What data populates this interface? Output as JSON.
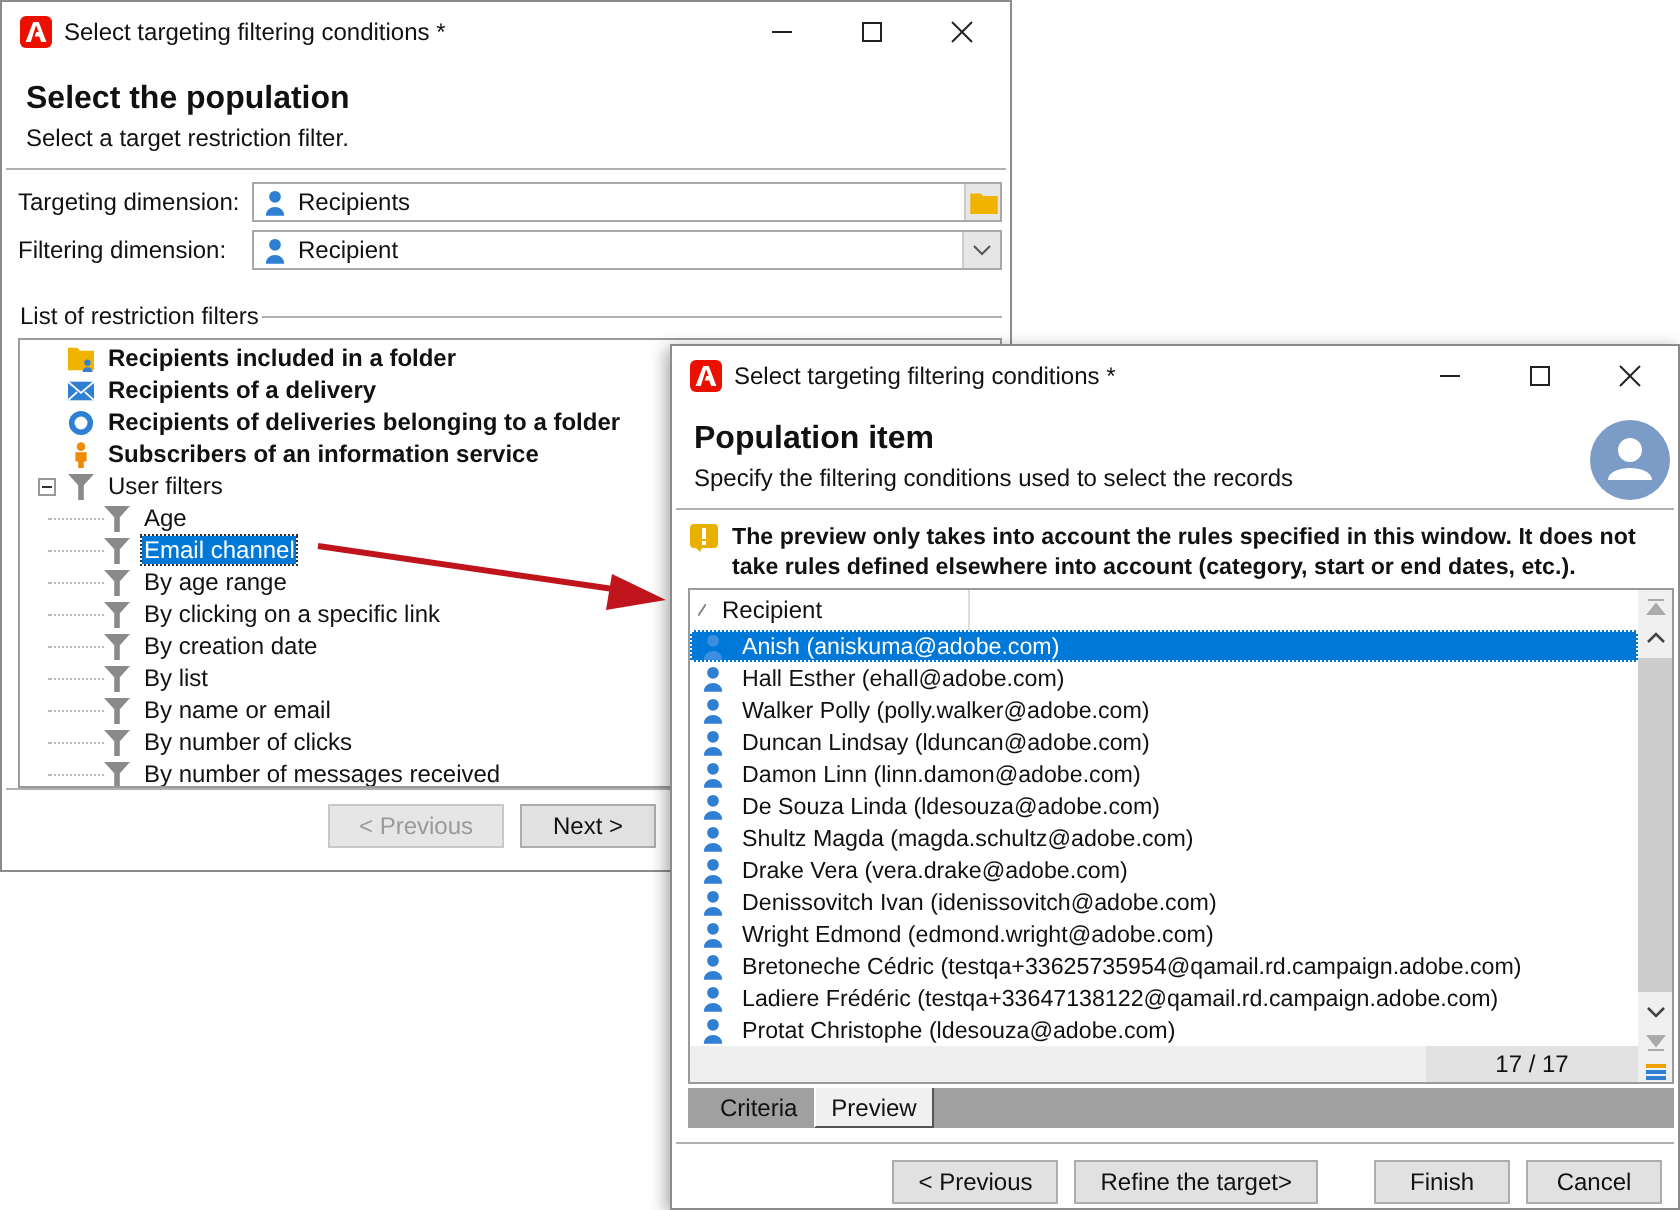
{
  "back_window": {
    "title": "Select targeting filtering conditions *",
    "header": {
      "title": "Select the population",
      "subtitle": "Select a target restriction filter."
    },
    "targeting_dimension": {
      "label": "Targeting dimension:",
      "value": "Recipients"
    },
    "filtering_dimension": {
      "label": "Filtering dimension:",
      "value": "Recipient"
    },
    "filters_section": {
      "label": "List of restriction filters"
    },
    "tree": [
      {
        "label": "Recipients included in a folder",
        "kind": "folder"
      },
      {
        "label": "Recipients of a delivery",
        "kind": "delivery"
      },
      {
        "label": "Recipients of deliveries belonging to a folder",
        "kind": "delivery-folder"
      },
      {
        "label": "Subscribers of an information service",
        "kind": "service"
      },
      {
        "label": "User filters",
        "kind": "filter",
        "expanded": true,
        "children": [
          {
            "label": "Age",
            "selected": false
          },
          {
            "label": "Email channel",
            "selected": true
          },
          {
            "label": "By age range",
            "selected": false
          },
          {
            "label": "By clicking on a specific link",
            "selected": false
          },
          {
            "label": "By creation date",
            "selected": false
          },
          {
            "label": "By list",
            "selected": false
          },
          {
            "label": "By name or email",
            "selected": false
          },
          {
            "label": "By number of clicks",
            "selected": false
          },
          {
            "label": "By number of messages received",
            "selected": false
          }
        ]
      }
    ],
    "buttons": [
      {
        "label": "< Previous",
        "disabled": true
      },
      {
        "label": "Next >",
        "disabled": false
      }
    ]
  },
  "front_window": {
    "title": "Select targeting filtering conditions *",
    "header": {
      "title": "Population item",
      "subtitle": "Specify the filtering conditions used to select the records"
    },
    "warning": "The preview only takes into account the rules specified in this window. It does not take rules defined elsewhere into account (category, start or end dates, etc.).",
    "list": {
      "column": "Recipient",
      "rows": [
        {
          "label": "Anish (aniskuma@adobe.com)",
          "selected": true
        },
        {
          "label": "Hall Esther (ehall@adobe.com)",
          "selected": false
        },
        {
          "label": "Walker Polly (polly.walker@adobe.com)",
          "selected": false
        },
        {
          "label": "Duncan Lindsay (lduncan@adobe.com)",
          "selected": false
        },
        {
          "label": "Damon Linn (linn.damon@adobe.com)",
          "selected": false
        },
        {
          "label": "De Souza Linda (ldesouza@adobe.com)",
          "selected": false
        },
        {
          "label": "Shultz Magda (magda.schultz@adobe.com)",
          "selected": false
        },
        {
          "label": "Drake Vera (vera.drake@adobe.com)",
          "selected": false
        },
        {
          "label": "Denissovitch Ivan (idenissovitch@adobe.com)",
          "selected": false
        },
        {
          "label": "Wright Edmond (edmond.wright@adobe.com)",
          "selected": false
        },
        {
          "label": "Bretoneche Cédric (testqa+33625735954@qamail.rd.campaign.adobe.com)",
          "selected": false
        },
        {
          "label": "Ladiere Frédéric (testqa+33647138122@qamail.rd.campaign.adobe.com)",
          "selected": false
        },
        {
          "label": "Protat Christophe (ldesouza@adobe.com)",
          "selected": false
        }
      ],
      "count": "17 / 17"
    },
    "tabs": [
      {
        "label": "Criteria",
        "selected": false
      },
      {
        "label": "Preview",
        "selected": true
      }
    ],
    "nav_buttons": [
      {
        "label": "< Previous",
        "disabled": false
      },
      {
        "label": "Refine the target>",
        "disabled": false
      }
    ],
    "action_buttons": [
      {
        "label": "Finish",
        "disabled": false
      },
      {
        "label": "Cancel",
        "disabled": false
      }
    ]
  }
}
